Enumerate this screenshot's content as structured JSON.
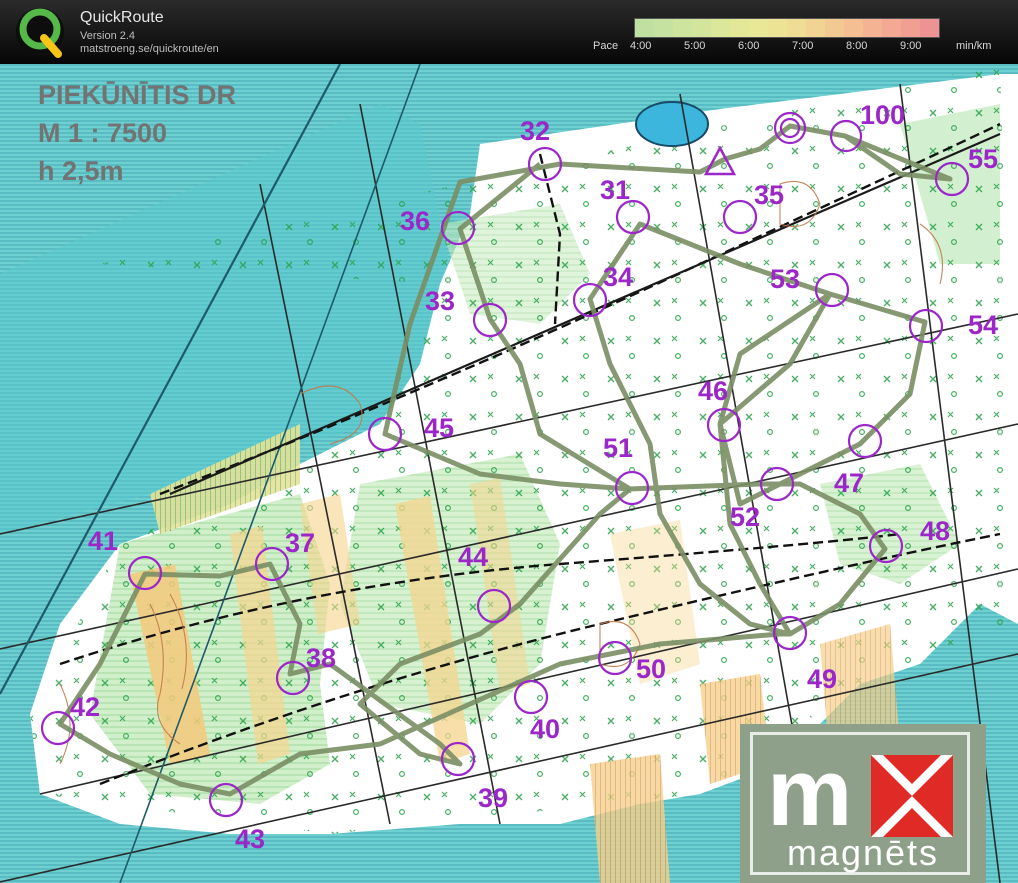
{
  "header": {
    "app_name": "QuickRoute",
    "version": "Version 2.4",
    "url": "matstroeng.se/quickroute/en",
    "logo_letter": "Q",
    "pace_label": "Pace",
    "pace_ticks": [
      "4:00",
      "5:00",
      "6:00",
      "7:00",
      "8:00",
      "9:00"
    ],
    "pace_unit": "min/km"
  },
  "map": {
    "title_line1": "PIEKŪNĪTIS DR",
    "title_line2": "M 1 : 7500",
    "title_line3": "h 2,5m",
    "route_color": "#7a8e64",
    "control_color": "#9b27c9",
    "controls": [
      "32",
      "100",
      "55",
      "36",
      "31",
      "35",
      "34",
      "53",
      "33",
      "54",
      "46",
      "45",
      "51",
      "47",
      "52",
      "48",
      "41",
      "37",
      "44",
      "38",
      "50",
      "49",
      "42",
      "40",
      "39",
      "43"
    ]
  },
  "sponsor": {
    "mark": "m",
    "word": "magnēts",
    "accent": "#e02a26"
  }
}
